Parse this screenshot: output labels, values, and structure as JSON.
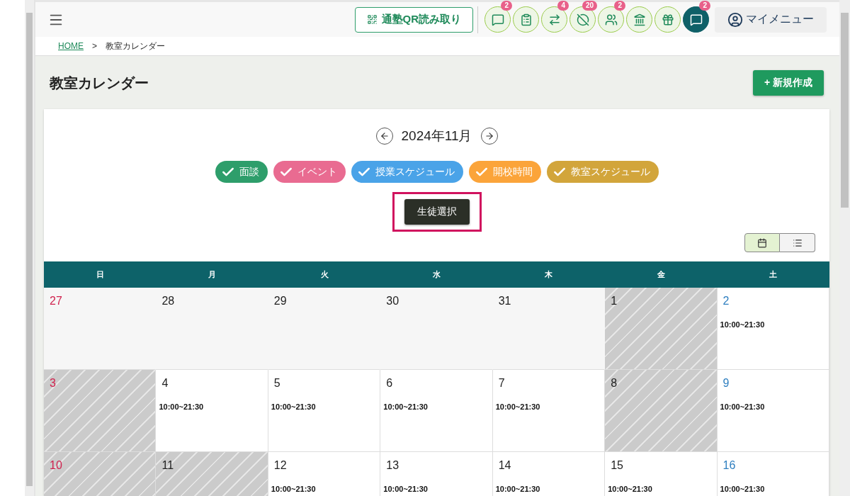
{
  "header": {
    "qr_button": "通塾QR読み取り",
    "icons": [
      {
        "kind": "chat",
        "badge": "2",
        "selected": false
      },
      {
        "kind": "checklist",
        "selected": false
      },
      {
        "kind": "transfer",
        "badge": "4",
        "selected": false
      },
      {
        "kind": "blocked",
        "badge": "20",
        "selected": false
      },
      {
        "kind": "group",
        "badge": "2",
        "selected": false
      },
      {
        "kind": "school",
        "selected": false
      },
      {
        "kind": "gift",
        "selected": false
      },
      {
        "kind": "chat",
        "badge": "2",
        "selected": true
      }
    ],
    "my_menu": "マイメニュー"
  },
  "breadcrumb": [
    {
      "label": "HOME",
      "kind": "link"
    },
    {
      "label": ">",
      "kind": "separator"
    },
    {
      "label": "教室カレンダー",
      "kind": "current"
    }
  ],
  "page_title": "教室カレンダー",
  "new_button": "+ 新規作成",
  "calendar": {
    "month": "2024年11月",
    "legend": [
      {
        "label": "面談",
        "color": "#2e9e6b",
        "checked": true
      },
      {
        "label": "イベント",
        "color": "#e96b91",
        "checked": true
      },
      {
        "label": "授業スケジュール",
        "color": "#4aa3e8",
        "checked": true
      },
      {
        "label": "開校時間",
        "color": "#fba43a",
        "checked": true
      },
      {
        "label": "教室スケジュール",
        "color": "#d2a53b",
        "checked": true
      }
    ],
    "student_button": {
      "label": "生徒選択",
      "highlighted": true
    },
    "views": [
      {
        "kind": "calendar",
        "selected": true
      },
      {
        "kind": "list",
        "selected": false
      }
    ],
    "weekdays": [
      "日",
      "月",
      "火",
      "水",
      "木",
      "金",
      "土"
    ],
    "weeks": [
      [
        {
          "day": "27",
          "kind": "outside"
        },
        {
          "day": "28",
          "kind": "outside"
        },
        {
          "day": "29",
          "kind": "outside"
        },
        {
          "day": "30",
          "kind": "outside"
        },
        {
          "day": "31",
          "kind": "outside"
        },
        {
          "day": "1",
          "kind": "closed"
        },
        {
          "day": "2",
          "kind": "open",
          "time": "10:00~21:30"
        }
      ],
      [
        {
          "day": "3",
          "kind": "closed"
        },
        {
          "day": "4",
          "kind": "open",
          "time": "10:00~21:30"
        },
        {
          "day": "5",
          "kind": "open",
          "time": "10:00~21:30"
        },
        {
          "day": "6",
          "kind": "open",
          "time": "10:00~21:30"
        },
        {
          "day": "7",
          "kind": "open",
          "time": "10:00~21:30"
        },
        {
          "day": "8",
          "kind": "closed"
        },
        {
          "day": "9",
          "kind": "open",
          "time": "10:00~21:30"
        }
      ],
      [
        {
          "day": "10",
          "kind": "closed"
        },
        {
          "day": "11",
          "kind": "closed"
        },
        {
          "day": "12",
          "kind": "open",
          "time": "10:00~21:30"
        },
        {
          "day": "13",
          "kind": "open",
          "time": "10:00~21:30"
        },
        {
          "day": "14",
          "kind": "open",
          "time": "10:00~21:30"
        },
        {
          "day": "15",
          "kind": "open",
          "time": "10:00~21:30"
        },
        {
          "day": "16",
          "kind": "open",
          "time": "10:00~21:30"
        }
      ]
    ]
  }
}
